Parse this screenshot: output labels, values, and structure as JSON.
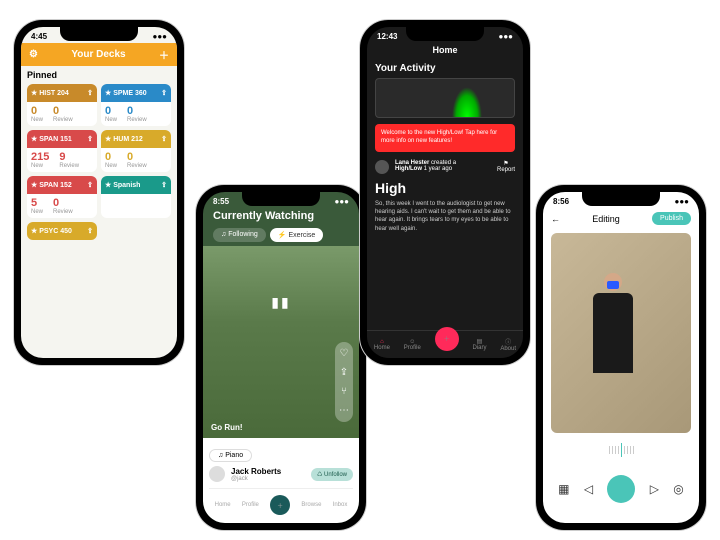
{
  "p1": {
    "time": "4:45",
    "title": "Your Decks",
    "section": "Pinned",
    "cards": [
      {
        "name": "HIST 204",
        "color": "#c88a2a",
        "new": "0",
        "review": "0"
      },
      {
        "name": "SPME 360",
        "color": "#2a8ac8",
        "new": "0",
        "review": "0"
      },
      {
        "name": "SPAN 151",
        "color": "#d84a4a",
        "new": "215",
        "review": "9"
      },
      {
        "name": "HUM 212",
        "color": "#d8aa2a",
        "new": "0",
        "review": "0"
      },
      {
        "name": "SPAN 152",
        "color": "#d84a4a",
        "new": "5",
        "review": "0"
      },
      {
        "name": "Spanish",
        "color": "#1a9a8a",
        "new": "",
        "review": ""
      },
      {
        "name": "PSYC 450",
        "color": "#d8aa2a",
        "new": "",
        "review": ""
      }
    ],
    "labels": {
      "new": "New",
      "review": "Review"
    }
  },
  "p2": {
    "time": "8:55",
    "title": "Currently Watching",
    "tabs": [
      "Following",
      "Exercise"
    ],
    "golabel": "Go Run!",
    "pill": "Piano",
    "user": {
      "name": "Jack Roberts",
      "sub": "@jack"
    },
    "unfollow": "Unfollow",
    "nav": [
      "Home",
      "Profile",
      "",
      "Browse",
      "Inbox"
    ]
  },
  "p3": {
    "time": "12:43",
    "header": "Home",
    "activity": "Your Activity",
    "banner": "Welcome to the new High/Low! Tap here for more info on new features!",
    "post": {
      "author": "Lana Hester",
      "action": "created a",
      "object": "High/Low",
      "when": "1 year ago"
    },
    "report": "Report",
    "title": "High",
    "text": "So, this week I went to the audiologist to get new hearing aids. I can't wait to get them and be able to hear again. It brings tears to my eyes to be able to hear well again.",
    "nav": [
      "Home",
      "Profile",
      "",
      "Diary",
      "About"
    ]
  },
  "p4": {
    "time": "8:56",
    "title": "Editing",
    "publish": "Publish"
  }
}
